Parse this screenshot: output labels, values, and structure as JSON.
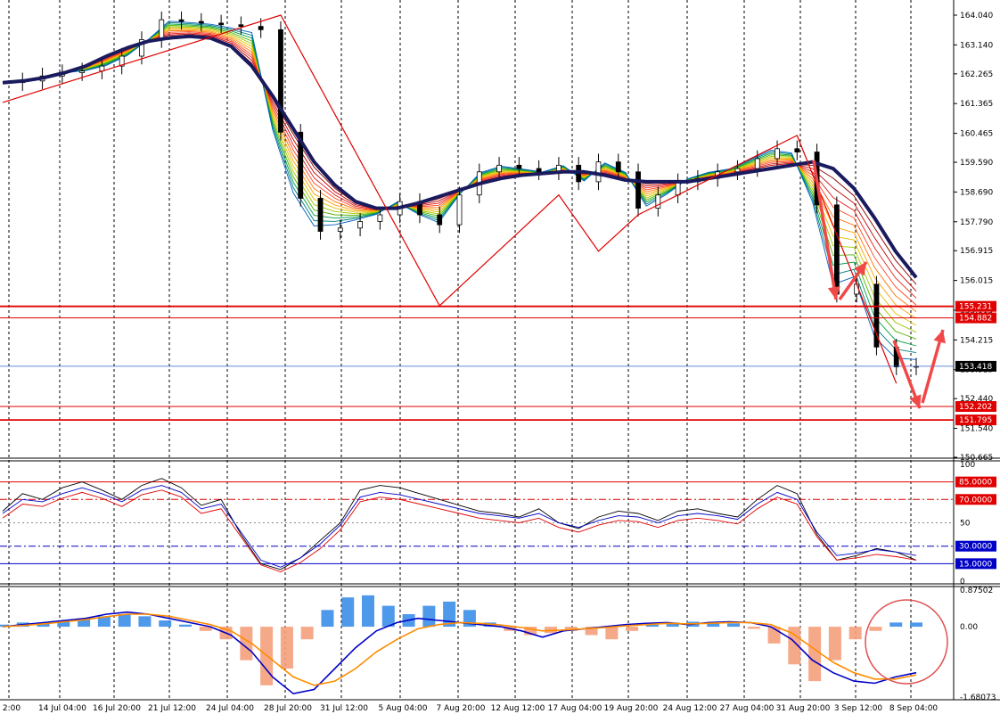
{
  "chart_data": {
    "type": "candlestick",
    "instrument_panels": [
      "price",
      "stochastic",
      "macd"
    ],
    "time_labels": [
      "2:00",
      "14 Jul 04:00",
      "16 Jul 20:00",
      "21 Jul 12:00",
      "24 Jul 04:00",
      "28 Jul 20:00",
      "31 Jul 12:00",
      "5 Aug 04:00",
      "7 Aug 20:00",
      "12 Aug 12:00",
      "17 Aug 04:00",
      "19 Aug 20:00",
      "24 Aug 12:00",
      "27 Aug 04:00",
      "31 Aug 20:00",
      "3 Sep 12:00",
      "8 Sep 04:00"
    ],
    "price_axis": {
      "ticks": [
        "164.040",
        "163.140",
        "162.265",
        "161.365",
        "160.465",
        "159.590",
        "158.690",
        "157.790",
        "156.915",
        "156.015",
        "155.115",
        "154.215",
        "153.315",
        "152.440",
        "151.540",
        "150.665"
      ],
      "ylim": [
        150.665,
        164.04
      ]
    },
    "current_price": "153.418",
    "price_levels": [
      {
        "value": "155.231",
        "color": "#e00000"
      },
      {
        "value": "154.882",
        "color": "#e00000"
      },
      {
        "value": "152.202",
        "color": "#e00000"
      },
      {
        "value": "151.795",
        "color": "#e00000"
      }
    ],
    "close_series": [
      162.0,
      162.05,
      162.2,
      162.3,
      162.35,
      162.5,
      162.8,
      163.3,
      163.9,
      163.85,
      163.8,
      163.75,
      163.7,
      163.6,
      160.5,
      158.5,
      157.5,
      157.6,
      157.8,
      158.0,
      158.4,
      158.0,
      157.7,
      158.6,
      159.3,
      159.5,
      159.4,
      159.3,
      159.5,
      159.0,
      159.6,
      159.3,
      158.2,
      158.6,
      159.0,
      159.1,
      159.3,
      159.4,
      159.7,
      160.0,
      159.9,
      158.3,
      155.6,
      155.9,
      154.0,
      153.4,
      153.418
    ],
    "ma_trend_line": [
      162.0,
      162.05,
      162.15,
      162.3,
      162.5,
      162.8,
      163.05,
      163.25,
      163.35,
      163.4,
      163.35,
      163.1,
      162.5,
      161.6,
      160.6,
      159.6,
      158.9,
      158.4,
      158.2,
      158.2,
      158.35,
      158.55,
      158.75,
      158.95,
      159.1,
      159.2,
      159.25,
      159.3,
      159.3,
      159.2,
      159.05,
      159.0,
      159.0,
      159.0,
      159.1,
      159.2,
      159.3,
      159.4,
      159.5,
      159.6,
      159.4,
      158.8,
      157.9,
      156.9,
      156.1
    ],
    "zigzag_points": [
      [
        0,
        161.4
      ],
      [
        14,
        164.04
      ],
      [
        22,
        155.25
      ],
      [
        28,
        158.6
      ],
      [
        30,
        156.9
      ],
      [
        32,
        158.0
      ],
      [
        38,
        159.8
      ],
      [
        40,
        160.4
      ],
      [
        45,
        152.9
      ]
    ],
    "stochastic": {
      "ticks": [
        "100",
        "50",
        "0"
      ],
      "levels": [
        {
          "value": "85.0000",
          "color": "#e00000"
        },
        {
          "value": "70.0000",
          "color": "#e00000"
        },
        {
          "value": "30.0000",
          "color": "#0000c8"
        },
        {
          "value": "15.0000",
          "color": "#0000c8"
        }
      ],
      "main": [
        60,
        75,
        70,
        80,
        85,
        78,
        70,
        82,
        88,
        80,
        65,
        70,
        40,
        15,
        10,
        20,
        35,
        50,
        78,
        82,
        80,
        75,
        70,
        65,
        60,
        58,
        55,
        62,
        50,
        45,
        55,
        60,
        58,
        52,
        60,
        62,
        58,
        55,
        70,
        82,
        75,
        40,
        18,
        22,
        28,
        25,
        18
      ],
      "signal": [
        58,
        70,
        68,
        75,
        80,
        75,
        68,
        78,
        82,
        76,
        62,
        66,
        42,
        18,
        12,
        20,
        32,
        48,
        72,
        76,
        74,
        70,
        66,
        62,
        58,
        56,
        54,
        58,
        50,
        46,
        52,
        56,
        55,
        50,
        56,
        58,
        56,
        53,
        66,
        76,
        70,
        42,
        22,
        24,
        27,
        25,
        22
      ]
    },
    "macd": {
      "ticks": [
        "0.87502",
        "0.00",
        "-1.68073"
      ],
      "histogram": [
        0.05,
        0.1,
        0.1,
        0.15,
        0.2,
        0.25,
        0.3,
        0.25,
        0.15,
        0.05,
        -0.1,
        -0.3,
        -0.8,
        -1.4,
        -1.0,
        -0.3,
        0.4,
        0.7,
        0.75,
        0.5,
        0.3,
        0.5,
        0.6,
        0.4,
        0.1,
        -0.1,
        -0.2,
        -0.15,
        -0.1,
        -0.2,
        -0.3,
        -0.1,
        0.05,
        0.1,
        0.12,
        0.1,
        0.08,
        -0.05,
        -0.4,
        -0.9,
        -1.3,
        -0.8,
        -0.3,
        -0.1,
        0.1,
        0.1
      ],
      "macd_line": [
        0.0,
        0.05,
        0.1,
        0.15,
        0.2,
        0.3,
        0.35,
        0.3,
        0.2,
        0.1,
        0.0,
        -0.2,
        -0.6,
        -1.2,
        -1.6,
        -1.5,
        -1.0,
        -0.5,
        -0.1,
        0.1,
        0.2,
        0.15,
        0.1,
        0.05,
        0.0,
        -0.1,
        -0.25,
        -0.1,
        -0.05,
        0.0,
        0.05,
        0.08,
        0.1,
        0.05,
        0.1,
        0.12,
        0.1,
        0.0,
        -0.3,
        -0.8,
        -1.1,
        -1.3,
        -1.35,
        -1.2,
        -1.1
      ],
      "signal_line": [
        0.0,
        0.03,
        0.07,
        0.12,
        0.17,
        0.24,
        0.3,
        0.3,
        0.25,
        0.15,
        0.05,
        -0.1,
        -0.4,
        -0.8,
        -1.2,
        -1.4,
        -1.3,
        -1.0,
        -0.6,
        -0.3,
        -0.05,
        0.05,
        0.1,
        0.08,
        0.04,
        -0.02,
        -0.1,
        -0.08,
        -0.05,
        -0.02,
        0.02,
        0.05,
        0.08,
        0.07,
        0.08,
        0.1,
        0.1,
        0.05,
        -0.15,
        -0.5,
        -0.85,
        -1.1,
        -1.25,
        -1.25,
        -1.15
      ]
    }
  },
  "colors": {
    "ma_trend": "#1a1a5e",
    "zigzag": "#e00000",
    "arrow": "#f04848",
    "hist_pos": "#3c8ee8",
    "hist_neg": "#f4a07c",
    "stoch_main": "#000000",
    "stoch_signal_a": "#0000c8",
    "stoch_signal_b": "#e00000",
    "macd_line": "#0000c8",
    "macd_signal": "#ff8c00"
  }
}
